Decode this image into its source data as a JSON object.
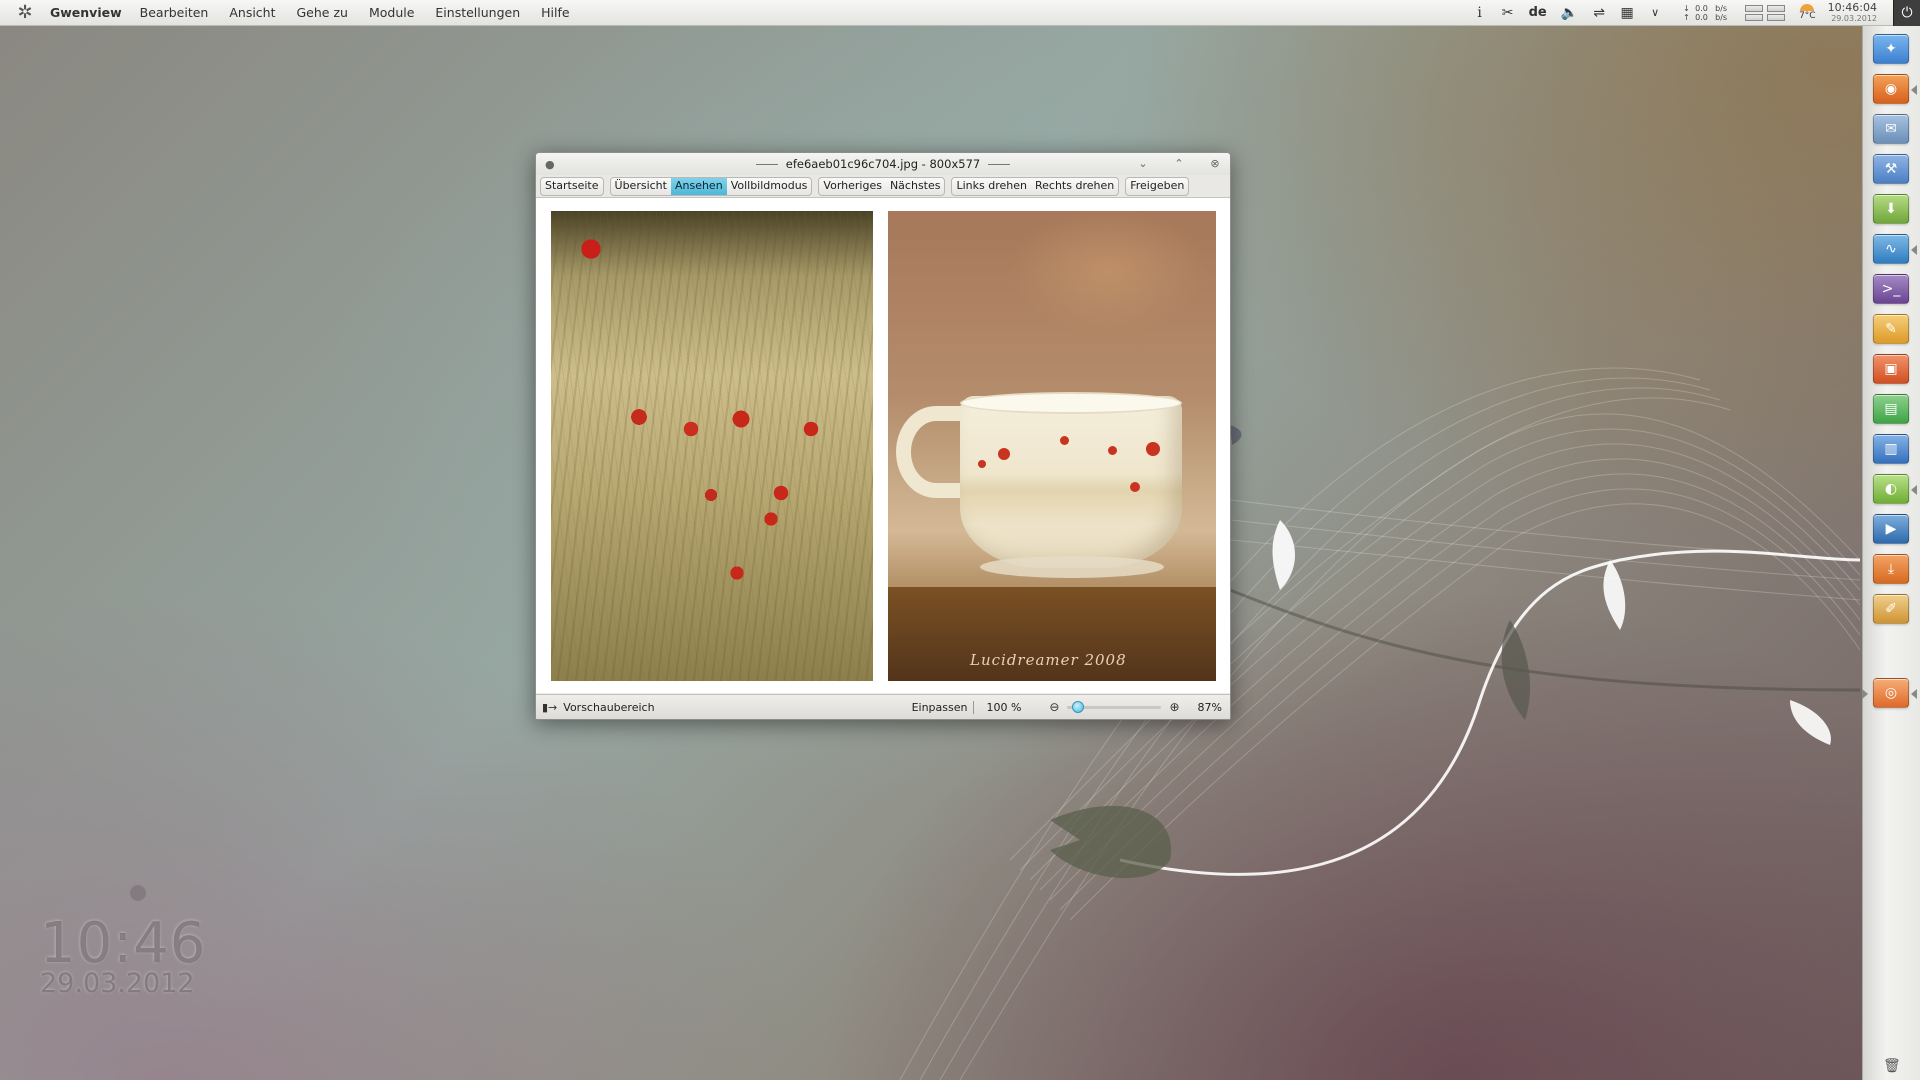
{
  "top_panel": {
    "app_name": "Gwenview",
    "menu": [
      "Bearbeiten",
      "Ansicht",
      "Gehe zu",
      "Module",
      "Einstellungen",
      "Hilfe"
    ],
    "tray": {
      "info_icon": "info-icon",
      "keyboard_layout": "de",
      "net_down": "0.0",
      "net_up": "0.0",
      "net_unit": "b/s",
      "temperature": "7°C",
      "time": "10:46:04",
      "date": "29.03.2012"
    }
  },
  "window": {
    "title": "efe6aeb01c96c704.jpg - 800x577",
    "toolbar": {
      "groups": [
        [
          "Startseite"
        ],
        [
          "Übersicht",
          "Ansehen",
          "Vollbildmodus"
        ],
        [
          "Vorheriges",
          "Nächstes"
        ],
        [
          "Links drehen",
          "Rechts drehen"
        ],
        [
          "Freigeben"
        ]
      ],
      "active": "Ansehen"
    },
    "image_signature": "Lucidreamer 2008",
    "statusbar": {
      "panel_label": "Vorschaubereich",
      "fit_label": "Einpassen",
      "fixed_zoom": "100 %",
      "zoom_value": "87%",
      "zoom_fraction": 0.06
    }
  },
  "desktop_clock": {
    "time": "10:46",
    "date": "29.03.2012"
  },
  "dock": {
    "items": [
      {
        "name": "dock-item-file-manager",
        "icon": "compass-icon",
        "color": "#4a90d9"
      },
      {
        "name": "dock-item-browser",
        "icon": "browser-icon",
        "color": "#e0702a"
      },
      {
        "name": "dock-item-mail",
        "icon": "mail-icon",
        "color": "#6b8fb8"
      },
      {
        "name": "dock-item-tools",
        "icon": "wrench-icon",
        "color": "#4b7fc4"
      },
      {
        "name": "dock-item-download",
        "icon": "download-icon",
        "color": "#7fb24a"
      },
      {
        "name": "dock-item-monitor",
        "icon": "monitor-icon",
        "color": "#3a86c7"
      },
      {
        "name": "dock-item-terminal",
        "icon": "terminal-icon",
        "color": "#7a4fa0"
      },
      {
        "name": "dock-item-notes",
        "icon": "notes-icon",
        "color": "#e0a030"
      },
      {
        "name": "dock-item-presentation",
        "icon": "presentation-icon",
        "color": "#d9582a"
      },
      {
        "name": "dock-item-spreadsheet",
        "icon": "spreadsheet-icon",
        "color": "#4caf50"
      },
      {
        "name": "dock-item-document",
        "icon": "document-icon",
        "color": "#3d7cc9"
      },
      {
        "name": "dock-item-image-viewer",
        "icon": "image-icon",
        "color": "#7fbf3f"
      },
      {
        "name": "dock-item-video",
        "icon": "video-icon",
        "color": "#3b78b8"
      },
      {
        "name": "dock-item-installer",
        "icon": "installer-icon",
        "color": "#e07a2a"
      },
      {
        "name": "dock-item-editor",
        "icon": "editor-icon",
        "color": "#d9a040"
      },
      {
        "name": "dock-item-viewer",
        "icon": "eye-icon",
        "color": "#e07030"
      }
    ]
  }
}
